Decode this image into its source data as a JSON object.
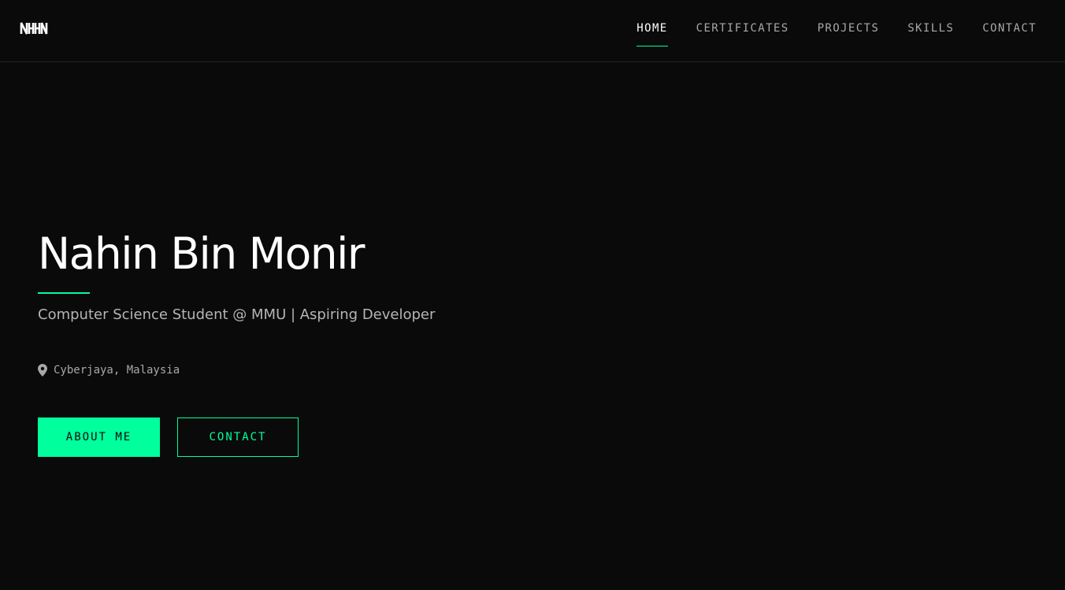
{
  "logo": {
    "text": "NBHN"
  },
  "nav": {
    "items": [
      {
        "label": "HOME",
        "active": true
      },
      {
        "label": "CERTIFICATES",
        "active": false
      },
      {
        "label": "PROJECTS",
        "active": false
      },
      {
        "label": "SKILLS",
        "active": false
      },
      {
        "label": "CONTACT",
        "active": false
      }
    ]
  },
  "hero": {
    "name": "Nahin Bin Monir",
    "subtitle": "Computer Science Student @ MMU | Aspiring Developer",
    "location": {
      "icon": "map-pin-icon",
      "text": "Cyberjaya, Malaysia"
    },
    "buttons": {
      "about": "ABOUT ME",
      "contact": "CONTACT"
    }
  },
  "colors": {
    "background": "#0a0a0a",
    "accent": "#00ff9d",
    "text_primary": "#ffffff",
    "text_muted": "#a8a8a8"
  }
}
